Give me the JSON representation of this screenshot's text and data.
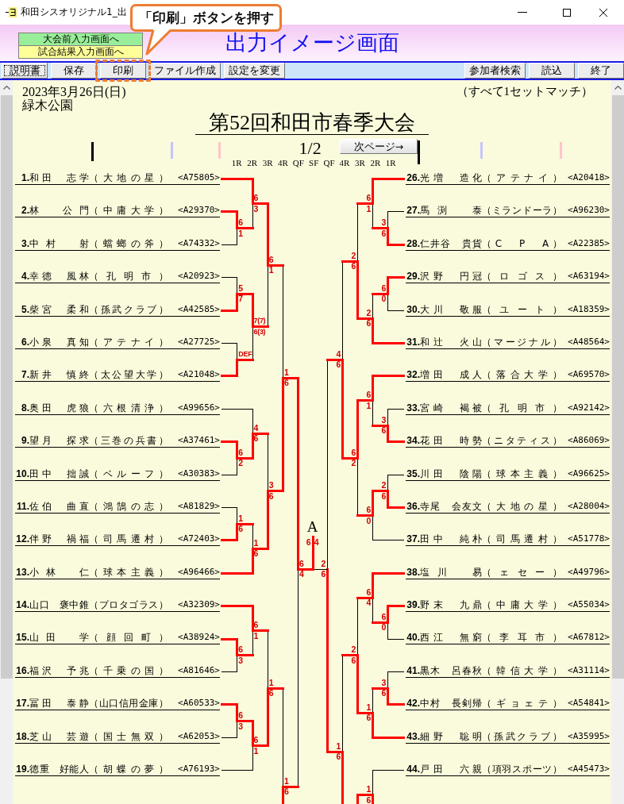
{
  "window": {
    "title": "和田シスオリジナル1_出"
  },
  "callout": {
    "text": "「印刷」ボタンを押す"
  },
  "header": {
    "nav_buttons": [
      {
        "label": "大会前入力画面へ",
        "color": "#99ee99"
      },
      {
        "label": "試合結果入力画面へ",
        "color": "#ffff99"
      }
    ],
    "title": "出力イメージ画面"
  },
  "toolbar": {
    "buttons": [
      {
        "label": "説明書",
        "focused": true,
        "highlighted": false
      },
      {
        "label": "保存",
        "focused": false,
        "highlighted": false
      },
      {
        "label": "印刷",
        "focused": false,
        "highlighted": true
      },
      {
        "label": "ファイル作成",
        "focused": false,
        "highlighted": false
      },
      {
        "label": "設定を変更",
        "focused": false,
        "highlighted": false
      }
    ],
    "right_buttons": [
      {
        "label": "参加者検索",
        "focused": false,
        "highlighted": false
      },
      {
        "label": "読込",
        "focused": false,
        "highlighted": false
      },
      {
        "label": "終了",
        "focused": false,
        "highlighted": false
      }
    ]
  },
  "sheet": {
    "date": "2023年3月26日(日)",
    "venue": "緑木公園",
    "note": "（すべて1セットマッチ）",
    "title": "第52回和田市春季大会",
    "page": "1/2",
    "next_button": "次ページ→",
    "rounds": [
      "1R",
      "2R",
      "3R",
      "4R",
      "QF",
      "SF",
      "QF",
      "4R",
      "3R",
      "2R",
      "1R"
    ],
    "bracket": {
      "left": {
        "kind": "match",
        "won": true,
        "top_score": "6",
        "bottom_score": "4",
        "slots": [
          {
            "kind": "match",
            "won": true,
            "top_score": "1",
            "bottom_score": "6",
            "slots": [
              {
                "kind": "match",
                "won": false,
                "top_score": "6",
                "bottom_score": "1",
                "slots": [
                  {
                    "kind": "match",
                    "won": true,
                    "top_score": "6",
                    "bottom_score": "3",
                    "slots": [
                      {
                        "kind": "player",
                        "won": true,
                        "seed": "1.",
                        "name": "和田　志学",
                        "team": "（大地の星）",
                        "code": "<A75805>"
                      },
                      {
                        "kind": "match",
                        "won": false,
                        "top_score": "6",
                        "bottom_score": "1",
                        "slots": [
                          {
                            "kind": "player",
                            "won": true,
                            "seed": "2.",
                            "name": "林　公門",
                            "team": "（中庸大学）",
                            "code": "<A29370>"
                          },
                          {
                            "kind": "player",
                            "won": false,
                            "seed": "3.",
                            "name": "中村　射",
                            "team": "（蟷螂の斧）",
                            "code": "<A74332>"
                          }
                        ]
                      }
                    ]
                  },
                  {
                    "kind": "match",
                    "won": false,
                    "top_score": "7(7)",
                    "bottom_score": "6(3)",
                    "slots": [
                      {
                        "kind": "match",
                        "won": true,
                        "top_score": "5",
                        "bottom_score": "7",
                        "slots": [
                          {
                            "kind": "player",
                            "won": false,
                            "seed": "4.",
                            "name": "幸徳　風林",
                            "team": "（孔明市）",
                            "code": "<A20923>"
                          },
                          {
                            "kind": "player",
                            "won": true,
                            "seed": "5.",
                            "name": "柴宮　柔和",
                            "team": "（孫武クラブ）",
                            "code": "<A42585>"
                          }
                        ]
                      },
                      {
                        "kind": "match",
                        "won": false,
                        "top_score": "DEF",
                        "slots": [
                          {
                            "kind": "player",
                            "won": false,
                            "seed": "6.",
                            "name": "小泉　真知",
                            "team": "（アテナイ）",
                            "code": "<A27725>"
                          },
                          {
                            "kind": "player",
                            "won": true,
                            "seed": "7.",
                            "name": "新井　慎終",
                            "team": "（太公望大学）",
                            "code": "<A21048>"
                          }
                        ]
                      }
                    ]
                  }
                ]
              },
              {
                "kind": "match",
                "won": true,
                "top_score": "3",
                "bottom_score": "6",
                "slots": [
                  {
                    "kind": "match",
                    "won": false,
                    "top_score": "4",
                    "bottom_score": "6",
                    "slots": [
                      {
                        "kind": "player",
                        "won": false,
                        "seed": "8.",
                        "name": "奥田　虎狼",
                        "team": "（六根清浄）",
                        "code": "<A99656>"
                      },
                      {
                        "kind": "match",
                        "won": true,
                        "top_score": "6",
                        "bottom_score": "2",
                        "slots": [
                          {
                            "kind": "player",
                            "won": true,
                            "seed": "9.",
                            "name": "望月　探求",
                            "team": "（三巻の兵書）",
                            "code": "<A37461>"
                          },
                          {
                            "kind": "player",
                            "won": false,
                            "seed": "10.",
                            "name": "田中　拙誠",
                            "team": "（ベルーフ）",
                            "code": "<A30383>"
                          }
                        ]
                      }
                    ]
                  },
                  {
                    "kind": "match",
                    "won": true,
                    "top_score": "1",
                    "bottom_score": "6",
                    "slots": [
                      {
                        "kind": "match",
                        "won": false,
                        "top_score": "1",
                        "bottom_score": "6",
                        "slots": [
                          {
                            "kind": "player",
                            "won": false,
                            "seed": "11.",
                            "name": "佐伯　曲直",
                            "team": "（鴻鵠の志）",
                            "code": "<A81829>"
                          },
                          {
                            "kind": "player",
                            "won": true,
                            "seed": "12.",
                            "name": "伴野　禍福",
                            "team": "（司馬遷村）",
                            "code": "<A72403>"
                          }
                        ]
                      },
                      {
                        "kind": "player",
                        "won": true,
                        "seed": "13.",
                        "name": "小林　仁",
                        "team": "（球本主義）",
                        "code": "<A96466>"
                      }
                    ]
                  }
                ]
              }
            ]
          },
          {
            "kind": "match",
            "won": false,
            "top_score": "1",
            "bottom_score": "6",
            "slots": [
              {
                "kind": "match",
                "won": false,
                "top_score": "1",
                "bottom_score": "6",
                "slots": [
                  {
                    "kind": "match",
                    "won": false,
                    "top_score": "6",
                    "bottom_score": "1",
                    "slots": [
                      {
                        "kind": "player",
                        "won": true,
                        "seed": "14.",
                        "name": "山口　褒中錐",
                        "team": "（プロタゴラス）",
                        "code": "<A32309>"
                      },
                      {
                        "kind": "match",
                        "won": false,
                        "top_score": "6",
                        "bottom_score": "3",
                        "slots": [
                          {
                            "kind": "player",
                            "won": true,
                            "seed": "15.",
                            "name": "山田　学",
                            "team": "（顔回町）",
                            "code": "<A38924>"
                          },
                          {
                            "kind": "player",
                            "won": false,
                            "seed": "16.",
                            "name": "福沢　予兆",
                            "team": "（千乗の国）",
                            "code": "<A81646>"
                          }
                        ]
                      }
                    ]
                  },
                  {
                    "kind": "match",
                    "won": true,
                    "top_score": "6",
                    "bottom_score": "1",
                    "slots": [
                      {
                        "kind": "match",
                        "won": true,
                        "top_score": "6",
                        "bottom_score": "3",
                        "slots": [
                          {
                            "kind": "player",
                            "won": true,
                            "seed": "17.",
                            "name": "冨田　泰静",
                            "team": "（山口信用金庫）",
                            "code": "<A60533>"
                          },
                          {
                            "kind": "player",
                            "won": false,
                            "seed": "18.",
                            "name": "芝山　芸遊",
                            "team": "（国士無双）",
                            "code": "<A62053>"
                          }
                        ]
                      },
                      {
                        "kind": "player",
                        "won": false,
                        "seed": "19.",
                        "name": "徳重　好能人",
                        "team": "（胡蝶の夢）",
                        "code": "<A76193>"
                      }
                    ]
                  }
                ]
              },
              {
                "kind": "offscreen",
                "won": true
              }
            ]
          }
        ]
      },
      "right": {
        "kind": "match",
        "won": false,
        "top_score": "2",
        "bottom_score": "6",
        "slots": [
          {
            "kind": "match",
            "won": false,
            "top_score": "4",
            "bottom_score": "6",
            "slots": [
              {
                "kind": "match",
                "won": false,
                "top_score": "2",
                "bottom_score": "6",
                "slots": [
                  {
                    "kind": "match",
                    "won": false,
                    "top_score": "6",
                    "bottom_score": "1",
                    "slots": [
                      {
                        "kind": "player",
                        "won": true,
                        "seed": "26.",
                        "name": "光増　造化",
                        "team": "（アテナイ）",
                        "code": "<A20418>"
                      },
                      {
                        "kind": "match",
                        "won": false,
                        "top_score": "3",
                        "bottom_score": "6",
                        "slots": [
                          {
                            "kind": "player",
                            "won": false,
                            "seed": "27.",
                            "name": "馬渕　泰",
                            "team": "（ミランドーラ）",
                            "code": "<A96230>"
                          },
                          {
                            "kind": "player",
                            "won": true,
                            "seed": "28.",
                            "name": "仁井谷　貴貨",
                            "team": "（C　P　A）",
                            "code": "<A22385>"
                          }
                        ]
                      }
                    ]
                  },
                  {
                    "kind": "match",
                    "won": true,
                    "top_score": "2",
                    "bottom_score": "6",
                    "slots": [
                      {
                        "kind": "match",
                        "won": false,
                        "top_score": "6",
                        "bottom_score": "0",
                        "slots": [
                          {
                            "kind": "player",
                            "won": true,
                            "seed": "29.",
                            "name": "沢野　円冠",
                            "team": "（ロゴス）",
                            "code": "<A63194>"
                          },
                          {
                            "kind": "player",
                            "won": false,
                            "seed": "30.",
                            "name": "大川　敬服",
                            "team": "（ユート）",
                            "code": "<A18359>"
                          }
                        ]
                      },
                      {
                        "kind": "player",
                        "won": true,
                        "seed": "31.",
                        "name": "和辻　火山",
                        "team": "（マージナル）",
                        "code": "<A48564>"
                      }
                    ]
                  }
                ]
              },
              {
                "kind": "match",
                "won": true,
                "top_score": "6",
                "bottom_score": "2",
                "slots": [
                  {
                    "kind": "match",
                    "won": true,
                    "top_score": "6",
                    "bottom_score": "1",
                    "slots": [
                      {
                        "kind": "player",
                        "won": true,
                        "seed": "32.",
                        "name": "増田　成人",
                        "team": "（落合大学）",
                        "code": "<A69570>"
                      },
                      {
                        "kind": "match",
                        "won": false,
                        "top_score": "3",
                        "bottom_score": "6",
                        "slots": [
                          {
                            "kind": "player",
                            "won": false,
                            "seed": "33.",
                            "name": "宮崎　褐被",
                            "team": "（孔明市）",
                            "code": "<A92142>"
                          },
                          {
                            "kind": "player",
                            "won": true,
                            "seed": "34.",
                            "name": "花田　時勢",
                            "team": "（ニタティス）",
                            "code": "<A86069>"
                          }
                        ]
                      }
                    ]
                  },
                  {
                    "kind": "match",
                    "won": false,
                    "top_score": "6",
                    "bottom_score": "0",
                    "slots": [
                      {
                        "kind": "match",
                        "won": true,
                        "top_score": "2",
                        "bottom_score": "6",
                        "slots": [
                          {
                            "kind": "player",
                            "won": false,
                            "seed": "35.",
                            "name": "川田　陰陽",
                            "team": "（球本主義）",
                            "code": "<A96625>"
                          },
                          {
                            "kind": "player",
                            "won": true,
                            "seed": "36.",
                            "name": "寺尾　会友文",
                            "team": "（大地の星）",
                            "code": "<A28004>"
                          }
                        ]
                      },
                      {
                        "kind": "player",
                        "won": false,
                        "seed": "37.",
                        "name": "田中　純朴",
                        "team": "（司馬遷村）",
                        "code": "<A51778>"
                      }
                    ]
                  }
                ]
              }
            ]
          },
          {
            "kind": "match",
            "won": true,
            "top_score": "1",
            "bottom_score": "6",
            "slots": [
              {
                "kind": "match",
                "won": false,
                "top_score": "2",
                "bottom_score": "6",
                "slots": [
                  {
                    "kind": "match",
                    "won": false,
                    "top_score": "6",
                    "bottom_score": "4",
                    "slots": [
                      {
                        "kind": "player",
                        "won": true,
                        "seed": "38.",
                        "name": "塩川　易",
                        "team": "（ェセー）",
                        "code": "<A49796>"
                      },
                      {
                        "kind": "match",
                        "won": false,
                        "top_score": "6",
                        "bottom_score": "0",
                        "slots": [
                          {
                            "kind": "player",
                            "won": true,
                            "seed": "39.",
                            "name": "野末　九鼎",
                            "team": "（中庸大学）",
                            "code": "<A55034>"
                          },
                          {
                            "kind": "player",
                            "won": false,
                            "seed": "40.",
                            "name": "西江　無窮",
                            "team": "（李耳市）",
                            "code": "<A67812>"
                          }
                        ]
                      }
                    ]
                  },
                  {
                    "kind": "match",
                    "won": true,
                    "top_score": "1",
                    "bottom_score": "6",
                    "slots": [
                      {
                        "kind": "match",
                        "won": false,
                        "top_score": "3",
                        "bottom_score": "6",
                        "slots": [
                          {
                            "kind": "player",
                            "won": false,
                            "seed": "41.",
                            "name": "黒木　呂春秋",
                            "team": "（韓信大学）",
                            "code": "<A31114>"
                          },
                          {
                            "kind": "player",
                            "won": true,
                            "seed": "42.",
                            "name": "中村　長剣帰",
                            "team": "（ギョェテ）",
                            "code": "<A54841>"
                          }
                        ]
                      },
                      {
                        "kind": "player",
                        "won": true,
                        "seed": "43.",
                        "name": "細野　聡明",
                        "team": "（孫武クラブ）",
                        "code": "<A35995>"
                      }
                    ]
                  }
                ]
              },
              {
                "kind": "match",
                "won": true,
                "slots": [
                  {
                    "kind": "match",
                    "won": true,
                    "top_score": "1",
                    "bottom_score": "6",
                    "slots": [
                      {
                        "kind": "player",
                        "won": false,
                        "seed": "44.",
                        "name": "戸田　六親",
                        "team": "（項羽スポーツ）",
                        "code": "<A45473>"
                      },
                      {
                        "kind": "offscreen",
                        "won": true
                      }
                    ]
                  },
                  {
                    "kind": "offscreen"
                  }
                ]
              }
            ]
          }
        ]
      },
      "final": {
        "label": "A",
        "left_score": "6",
        "right_score": "4"
      }
    }
  }
}
